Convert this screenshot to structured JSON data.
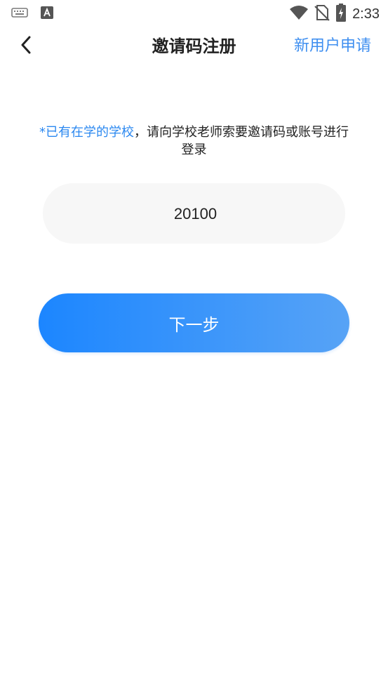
{
  "status_bar": {
    "time": "2:33",
    "icons": [
      "keyboard-icon",
      "a-app-icon",
      "wifi-icon",
      "no-sim-icon",
      "battery-charging-icon"
    ]
  },
  "header": {
    "back_icon": "chevron-left-icon",
    "title": "邀请码注册",
    "action_label": "新用户申请"
  },
  "notice": {
    "highlight": "*已有在学的学校",
    "rest": "，请向学校老师索要邀请码或账号进行登录"
  },
  "invite_code": {
    "value": "20100"
  },
  "next_button": {
    "label": "下一步"
  },
  "colors": {
    "accent": "#3f8ff0",
    "button_gradient_start": "#1c86ff",
    "button_gradient_end": "#57a3f6",
    "input_bg": "#f7f7f7"
  }
}
